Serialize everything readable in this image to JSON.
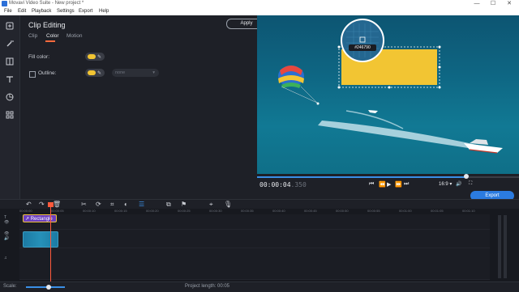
{
  "window": {
    "title": "Movavi Video Suite - New project *",
    "minimize": "—",
    "maximize": "☐",
    "close": "✕"
  },
  "menu": [
    "File",
    "Edit",
    "Playback",
    "Settings",
    "Export",
    "Help"
  ],
  "tools": [
    "import-icon",
    "magic-wand-icon",
    "transitions-icon",
    "titles-icon",
    "stickers-icon",
    "more-tools-icon"
  ],
  "panel": {
    "title": "Clip Editing",
    "apply_label": "Apply",
    "tabs": [
      "Clip",
      "Color",
      "Motion"
    ],
    "active_tab": "Color",
    "fill_label": "Fill color:",
    "outline_label": "Outline:",
    "outline_style": "none",
    "accent_color": "#ff6a3d"
  },
  "preview": {
    "color_readout": "#246790",
    "rectangle_color": "#f2c533"
  },
  "playback": {
    "time": "00:00:04",
    "time_ms": ".350",
    "progress": 0.8,
    "aspect": "16:9 ▾"
  },
  "export_label": "Export",
  "timeline": {
    "ruler": [
      "00:00:00",
      "00:00:05",
      "00:00:10",
      "00:00:15",
      "00:00:20",
      "00:00:25",
      "00:00:30",
      "00:00:35",
      "00:00:40",
      "00:00:45",
      "00:00:50",
      "00:00:55",
      "00:01:00",
      "00:01:05",
      "00:01:10"
    ],
    "title_clip": "Rectangle"
  },
  "status": {
    "scale_label": "Scale:",
    "project_length_label": "Project length:",
    "project_length": "00:05"
  }
}
